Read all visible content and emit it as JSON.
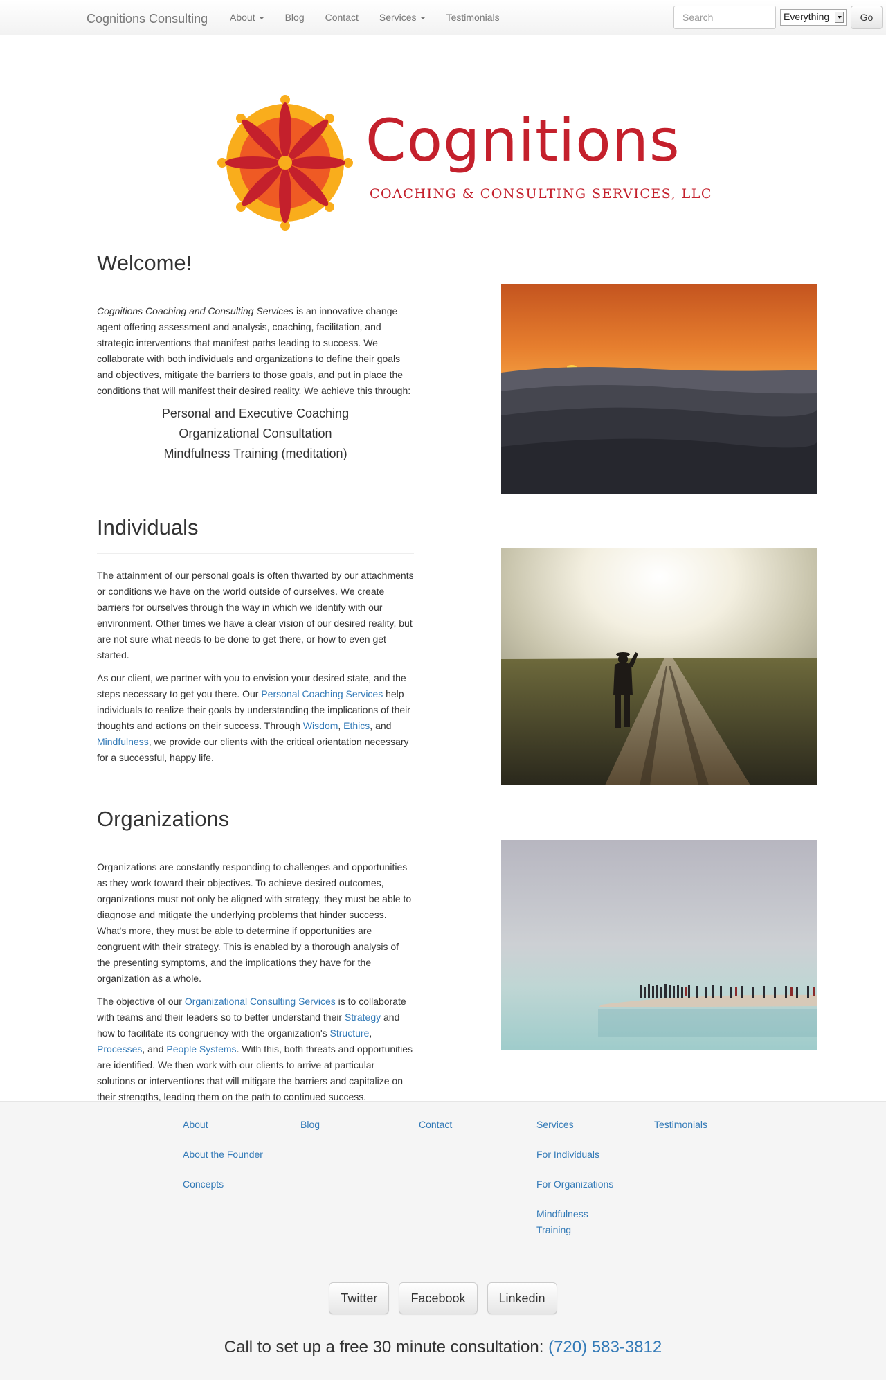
{
  "navbar": {
    "brand": "Cognitions Consulting",
    "links": [
      {
        "label": "About",
        "dropdown": true
      },
      {
        "label": "Blog",
        "dropdown": false
      },
      {
        "label": "Contact",
        "dropdown": false
      },
      {
        "label": "Services",
        "dropdown": true
      },
      {
        "label": "Testimonials",
        "dropdown": false
      }
    ],
    "search_placeholder": "Search",
    "scope_selected": "Everything",
    "go_label": "Go"
  },
  "logo": {
    "name": "Cognitions",
    "tagline": "COACHING & CONSULTING SERVICES, LLC",
    "colors": {
      "red": "#c4202c",
      "orange": "#ef5a24",
      "gold": "#f9ad1c"
    }
  },
  "welcome": {
    "title": "Welcome!",
    "intro_italic": "Cognitions Coaching and Consulting Services",
    "intro_rest": " is an innovative change agent offering assessment and analysis, coaching, facilitation, and strategic interventions that manifest paths leading to success. We collaborate with both individuals and organizations to define their goals and objectives, mitigate the barriers to those goals, and put in place the conditions that will manifest their desired reality. We achieve this through:",
    "services": [
      "Personal and Executive Coaching",
      "Organizational Consultation",
      "Mindfulness Training (meditation)"
    ]
  },
  "individuals": {
    "title": "Individuals",
    "p1": "The attainment of our personal goals is often thwarted by our attachments or conditions we have on the world outside of ourselves. We create barriers for ourselves through the way in which we identify with our environment. Other times we have a clear vision of our desired reality, but are not sure what needs to be done to get there, or how to even get started.",
    "p2_a": "As our client, we partner with you to envision your desired state, and the steps necessary to get you there. Our ",
    "p2_link1": "Personal Coaching Services",
    "p2_b": " help individuals to realize their goals by understanding the implications of their thoughts and actions on their success. Through ",
    "p2_link2": "Wisdom",
    "p2_c": ", ",
    "p2_link3": "Ethics",
    "p2_d": ", and ",
    "p2_link4": "Mindfulness",
    "p2_e": ", we provide our clients with the critical orientation necessary for a successful, happy life."
  },
  "organizations": {
    "title": "Organizations",
    "p1": "Organizations are constantly responding to challenges and opportunities as they work toward their objectives. To achieve desired outcomes, organizations must not only be aligned with strategy, they must be able to diagnose and mitigate the underlying problems that hinder success. What's more, they must be able to determine if opportunities are congruent with their strategy. This is enabled by a thorough analysis of the presenting symptoms, and the implications they have for the organization as a whole.",
    "p2_a": "The objective of our ",
    "p2_link1": "Organizational Consulting Services",
    "p2_b": " is to collaborate with teams and their leaders so to better understand their ",
    "p2_link2": "Strategy",
    "p2_c": " and how to facilitate its congruency with the organization's ",
    "p2_link3": "Structure",
    "p2_d": ", ",
    "p2_link4": "Processes",
    "p2_e": ", and ",
    "p2_link5": "People Systems",
    "p2_f": ". With this, both threats and opportunities are identified. We then work with our clients to arrive at particular solutions or interventions that will mitigate the barriers and capitalize on their strengths, leading them on the path to continued success."
  },
  "footer": {
    "columns": [
      [
        "About",
        "About the Founder",
        "Concepts"
      ],
      [
        "Blog"
      ],
      [
        "Contact"
      ],
      [
        "Services",
        "For Individuals",
        "For Organizations",
        "Mindfulness Training"
      ],
      [
        "Testimonials"
      ]
    ],
    "social": [
      "Twitter",
      "Facebook",
      "Linkedin"
    ],
    "cta_text": "Call to set up a free 30 minute consultation: ",
    "phone": "(720) 583-3812"
  },
  "colors": {
    "link": "#337ab7",
    "text": "#333333",
    "footer_bg": "#f5f5f5"
  }
}
